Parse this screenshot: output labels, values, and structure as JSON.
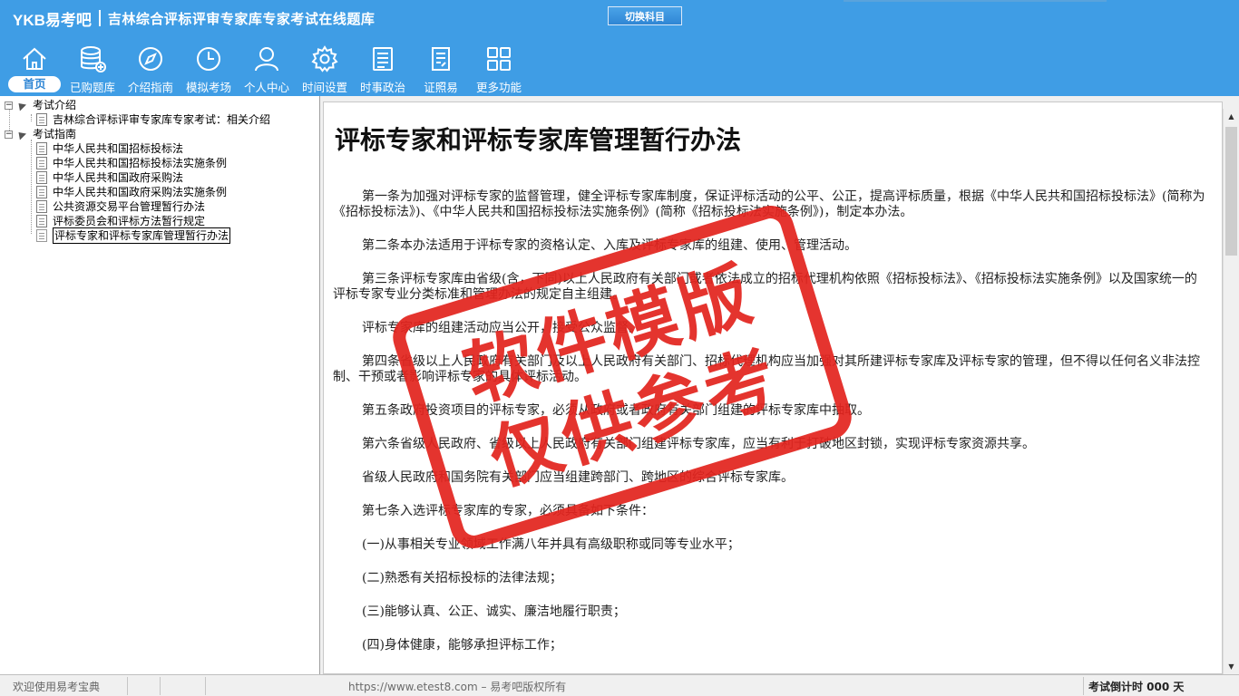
{
  "header": {
    "logo": "YKB易考吧",
    "title": "吉林综合评标评审专家库专家考试在线题库",
    "switch_button": "切换科目"
  },
  "nav": [
    {
      "label": "首页",
      "icon": "home-icon",
      "active": true
    },
    {
      "label": "已购题库",
      "icon": "database-icon"
    },
    {
      "label": "介绍指南",
      "icon": "compass-icon"
    },
    {
      "label": "模拟考场",
      "icon": "clock-icon"
    },
    {
      "label": "个人中心",
      "icon": "user-icon"
    },
    {
      "label": "时间设置",
      "icon": "gear-icon"
    },
    {
      "label": "时事政治",
      "icon": "newspaper-icon"
    },
    {
      "label": "证照易",
      "icon": "checklist-icon"
    },
    {
      "label": "更多功能",
      "icon": "grid-icon"
    }
  ],
  "tree": {
    "group1": "考试介绍",
    "group1_items": [
      "吉林综合评标评审专家库专家考试：相关介绍"
    ],
    "group2": "考试指南",
    "group2_items": [
      "中华人民共和国招标投标法",
      "中华人民共和国招标投标法实施条例",
      "中华人民共和国政府采购法",
      "中华人民共和国政府采购法实施条例",
      "公共资源交易平台管理暂行办法",
      "评标委员会和评标方法暂行规定",
      "评标专家和评标专家库管理暂行办法"
    ]
  },
  "document": {
    "title": "评标专家和评标专家库管理暂行办法",
    "paragraphs": [
      "第一条为加强对评标专家的监督管理，健全评标专家库制度，保证评标活动的公平、公正，提高评标质量，根据《中华人民共和国招标投标法》(简称为《招标投标法》)、《中华人民共和国招标投标法实施条例》(简称《招标投标法实施条例》)，制定本办法。",
      "第二条本办法适用于评标专家的资格认定、入库及评标专家库的组建、使用、管理活动。",
      "第三条评标专家库由省级(含，下同)以上人民政府有关部门或者依法成立的招标代理机构依照《招标投标法》、《招标投标法实施条例》以及国家统一的评标专家专业分类标准和管理办法的规定自主组建。",
      "评标专家库的组建活动应当公开，接受公众监督。",
      "第四条省级以上人民政府有关部门及以上人民政府有关部门、招标代理机构应当加强对其所建评标专家库及评标专家的管理，但不得以任何名义非法控制、干预或者影响评标专家的具体评标活动。",
      "第五条政府投资项目的评标专家，必须从政府或者政府有关部门组建的评标专家库中抽取。",
      "第六条省级人民政府、省级以上人民政府有关部门组建评标专家库，应当有利于打破地区封锁，实现评标专家资源共享。",
      "省级人民政府和国务院有关部门应当组建跨部门、跨地区的综合评标专家库。",
      "第七条入选评标专家库的专家，必须具备如下条件：",
      "(一)从事相关专业领域工作满八年并具有高级职称或同等专业水平；",
      "(二)熟悉有关招标投标的法律法规；",
      "(三)能够认真、公正、诚实、廉洁地履行职责；",
      "(四)身体健康，能够承担评标工作；"
    ]
  },
  "stamp": {
    "line1": "软件模版",
    "line2": "仅供参考",
    "color": "#e3251f"
  },
  "status": {
    "left": "欢迎使用易考宝典",
    "middle": "https://www.etest8.com – 易考吧版权所有",
    "right": "考试倒计时 000 天"
  },
  "colors": {
    "header": "#3f9de5",
    "accent": "#2f86d4"
  }
}
